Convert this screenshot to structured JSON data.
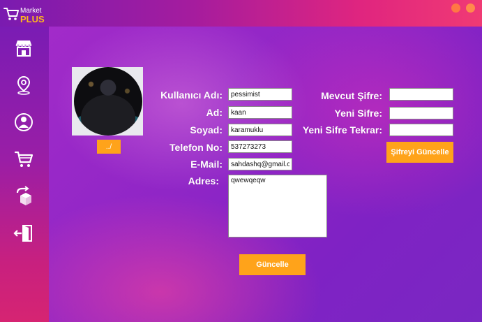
{
  "brand": {
    "market": "Market",
    "plus": "PLUS"
  },
  "sidebar": {
    "items": [
      {
        "icon": "store-icon"
      },
      {
        "icon": "location-pin-icon"
      },
      {
        "icon": "user-profile-icon"
      },
      {
        "icon": "shopping-cart-icon"
      },
      {
        "icon": "return-box-icon"
      },
      {
        "icon": "logout-icon"
      }
    ]
  },
  "profile": {
    "photo_button_label": "../",
    "labels": {
      "username": "Kullanıcı Adı:",
      "first_name": "Ad:",
      "last_name": "Soyad:",
      "phone": "Telefon No:",
      "email": "E-Mail:",
      "address": "Adres:"
    },
    "values": {
      "username": "pessimist",
      "first_name": "kaan",
      "last_name": "karamuklu",
      "phone": "537273273",
      "email": "sahdashq@gmail.com",
      "address": "qwewqeqw"
    },
    "update_button_label": "Güncelle"
  },
  "password": {
    "labels": {
      "current": "Mevcut Şifre:",
      "new": "Yeni Sifre:",
      "new_repeat": "Yeni Sifre Tekrar:"
    },
    "values": {
      "current": "",
      "new": "",
      "new_repeat": ""
    },
    "update_button_label": "Şifreyi Güncelle"
  },
  "colors": {
    "accent": "#ffa31a",
    "sidebar_top": "#7a1cb4",
    "sidebar_bottom": "#d62472",
    "titlebar_right": "#f03a74"
  }
}
